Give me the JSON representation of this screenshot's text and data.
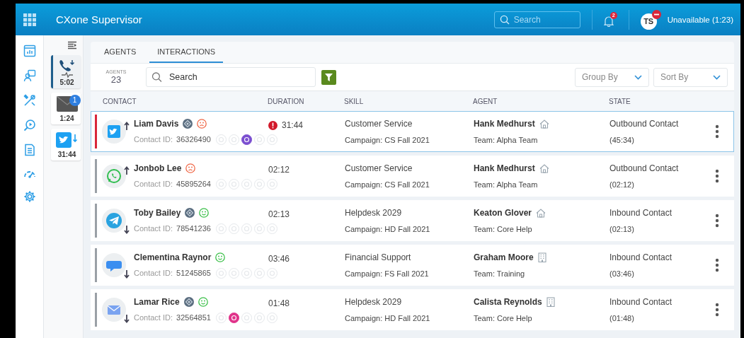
{
  "header": {
    "title": "CXone Supervisor",
    "search_placeholder": "Search",
    "notification_count": "2",
    "avatar_initials": "TS",
    "status": "Unavailable (1:23)"
  },
  "queue": [
    {
      "kind": "call",
      "time": "5:02",
      "selected": true
    },
    {
      "kind": "email",
      "time": "1:24",
      "badge": "1",
      "selected": false
    },
    {
      "kind": "twitter",
      "time": "31:44",
      "selected": false
    }
  ],
  "tabs": [
    {
      "label": "AGENTS",
      "selected": false
    },
    {
      "label": "INTERACTIONS",
      "selected": true
    }
  ],
  "toolbar": {
    "agents_label": "AGENTS",
    "agents_count": "23",
    "search_placeholder": "Search",
    "group_by": "Group By",
    "sort_by": "Sort By"
  },
  "columns": [
    "CONTACT",
    "DURATION",
    "SKILL",
    "AGENT",
    "STATE"
  ],
  "rows": [
    {
      "kind": "twitter",
      "outbound": true,
      "name": "Liam Davis",
      "monitored": true,
      "happy": false,
      "contact_id_label": "Contact ID:",
      "contact_id": "36326490",
      "actions": [
        false,
        false,
        true,
        false,
        false
      ],
      "alert": true,
      "duration": "31:44",
      "skill": "Customer Service",
      "campaign": "Campaign: CS Fall 2021",
      "agent": "Hank Medhurst",
      "at_home": true,
      "team": "Team: Alpha Team",
      "state": "Outbound Contact",
      "state_time": "(45:34)",
      "selected": true
    },
    {
      "kind": "whatsapp",
      "outbound": true,
      "name": "Jonbob Lee",
      "monitored": false,
      "happy": false,
      "contact_id_label": "Contact ID:",
      "contact_id": "45895264",
      "actions": [
        false,
        false,
        false,
        false,
        false
      ],
      "alert": false,
      "duration": "02:12",
      "skill": "Customer Service",
      "campaign": "Campaign: CS Fall 2021",
      "agent": "Hank Medhurst",
      "at_home": true,
      "team": "Team: Alpha Team",
      "state": "Outbound Contact",
      "state_time": "(02:12)",
      "selected": false
    },
    {
      "kind": "telegram",
      "outbound": false,
      "name": "Toby Bailey",
      "monitored": true,
      "happy": true,
      "contact_id_label": "Contact ID:",
      "contact_id": "78541236",
      "actions": [
        false,
        false,
        false,
        false,
        false
      ],
      "alert": false,
      "duration": "02:13",
      "skill": "Helpdesk 2029",
      "campaign": "Campaign: HD Fall 2021",
      "agent": "Keaton Glover",
      "at_home": true,
      "team": "Team: Core Help",
      "state": "Inbound Contact",
      "state_time": "(02:13)",
      "selected": false
    },
    {
      "kind": "chat",
      "outbound": false,
      "name": "Clementina Raynor",
      "monitored": false,
      "happy": true,
      "contact_id_label": "Contact ID:",
      "contact_id": "51245865",
      "actions": [
        false,
        false,
        false,
        false,
        false
      ],
      "alert": false,
      "duration": "03:46",
      "skill": "Financial Support",
      "campaign": "Campaign: FS Fall 2021",
      "agent": "Graham Moore",
      "at_home": false,
      "team": "Team: Training",
      "state": "Inbound Contact",
      "state_time": "(03:46)",
      "selected": false
    },
    {
      "kind": "email",
      "outbound": false,
      "name": "Lamar Rice",
      "monitored": true,
      "happy": true,
      "contact_id_label": "Contact ID:",
      "contact_id": "32564851",
      "actions": [
        false,
        true,
        false,
        false,
        false
      ],
      "alert": false,
      "duration": "01:48",
      "skill": "Helpdesk 2029",
      "campaign": "Campaign: HD Fall 2021",
      "agent": "Calista Reynolds",
      "at_home": false,
      "team": "Team: Core Help",
      "state": "Inbound Contact",
      "state_time": "(01:48)",
      "selected": false
    }
  ]
}
